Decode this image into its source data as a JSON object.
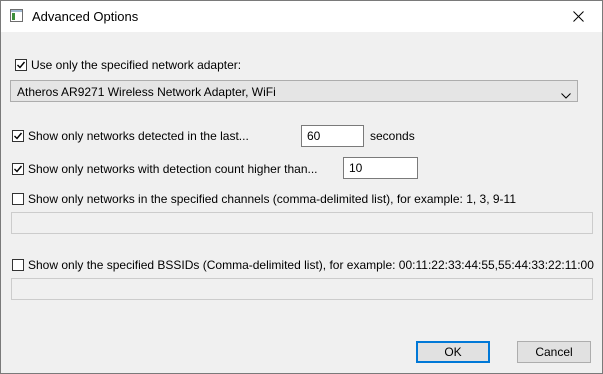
{
  "window": {
    "title": "Advanced Options"
  },
  "icons": {
    "app": "window-app-icon",
    "close": "close-icon",
    "dropdown": "chevron-down-icon",
    "check": "checkmark-icon"
  },
  "options": {
    "adapter": {
      "label": "Use only the specified network adapter:",
      "checked": true,
      "selected": "Atheros AR9271 Wireless Network Adapter, WiFi"
    },
    "detected_last": {
      "label": "Show only networks detected in the last...",
      "checked": true,
      "value": "60",
      "unit": "seconds"
    },
    "detection_count": {
      "label": "Show only networks with detection count higher than...",
      "checked": true,
      "value": "10"
    },
    "channels": {
      "label": "Show only networks in the specified channels (comma-delimited list), for example: 1, 3, 9-11",
      "checked": false,
      "value": ""
    },
    "bssids": {
      "label": "Show only the specified BSSIDs (Comma-delimited list), for example: 00:11:22:33:44:55,55:44:33:22:11:00",
      "checked": false,
      "value": ""
    }
  },
  "buttons": {
    "ok": "OK",
    "cancel": "Cancel"
  },
  "colors": {
    "accent": "#0078d7",
    "background": "#f0f0f0"
  }
}
